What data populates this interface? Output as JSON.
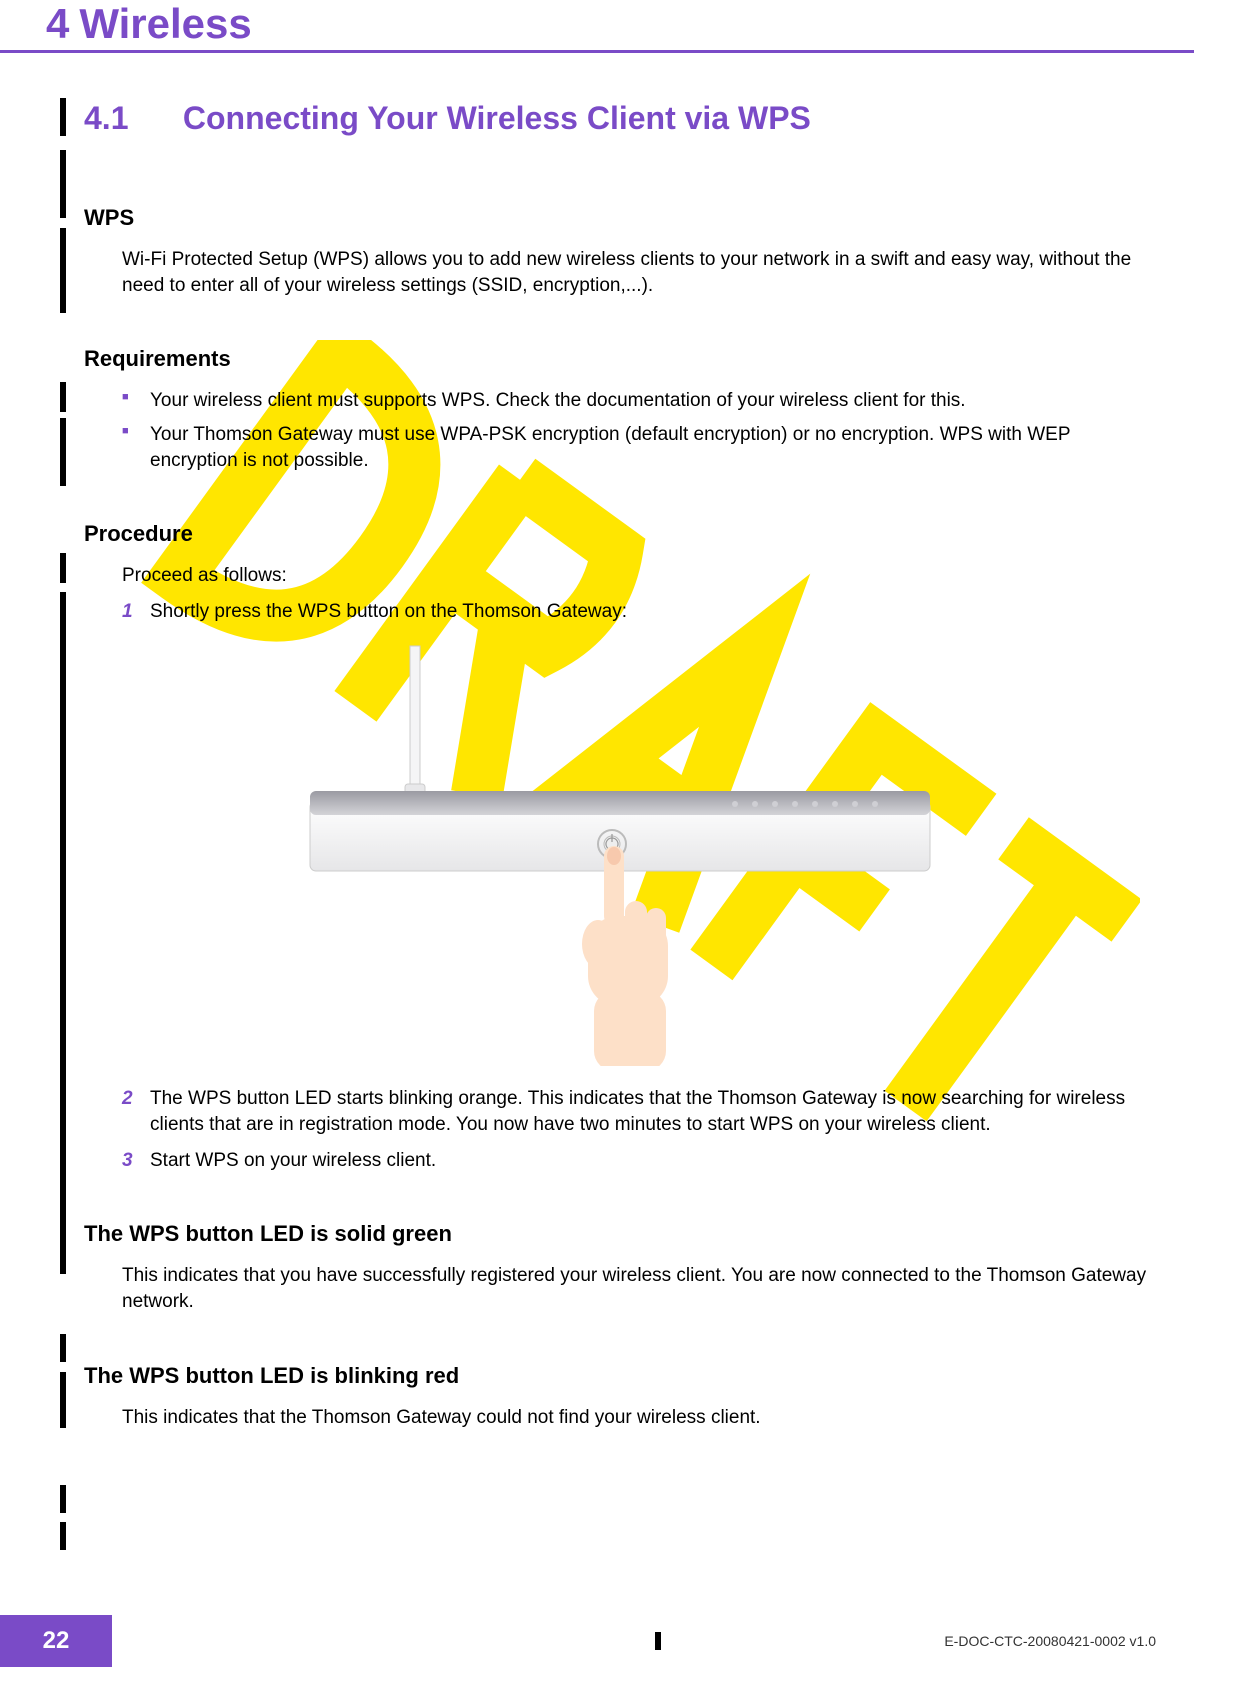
{
  "header": {
    "chapter_number": "4",
    "chapter_title": "Wireless"
  },
  "section": {
    "number": "4.1",
    "title": "Connecting Your Wireless Client via WPS"
  },
  "subsections": {
    "wps": {
      "title": "WPS",
      "text": "Wi-Fi Protected Setup (WPS) allows you to add new wireless clients to your network in a swift and easy way, without the need to enter all of your wireless settings (SSID, encryption,...)."
    },
    "requirements": {
      "title": "Requirements",
      "bullets": [
        "Your wireless client must supports WPS. Check the documentation of your wireless client for this.",
        "Your Thomson Gateway must use WPA-PSK encryption (default encryption) or no encryption. WPS with WEP encryption is not possible."
      ]
    },
    "procedure": {
      "title": "Procedure",
      "intro": "Proceed as follows:",
      "steps": [
        {
          "n": "1",
          "text": "Shortly press the WPS button on the Thomson Gateway:"
        },
        {
          "n": "2",
          "text": "The WPS button LED starts blinking orange. This indicates that the Thomson Gateway is now searching for wireless clients that are in registration mode. You now have two minutes to start WPS on your wireless client."
        },
        {
          "n": "3",
          "text": "Start WPS on your wireless client."
        }
      ]
    },
    "solid_green": {
      "title": "The WPS button LED is solid green",
      "text": "This indicates that you have successfully registered your wireless client. You are now connected to the Thomson Gateway network."
    },
    "blinking_red": {
      "title": "The WPS button LED is blinking red",
      "text": "This indicates that the Thomson Gateway could not find your wireless client."
    }
  },
  "footer": {
    "page_number": "22",
    "doc_ref": "E-DOC-CTC-20080421-0002 v1.0"
  },
  "watermark": "DRAFT"
}
